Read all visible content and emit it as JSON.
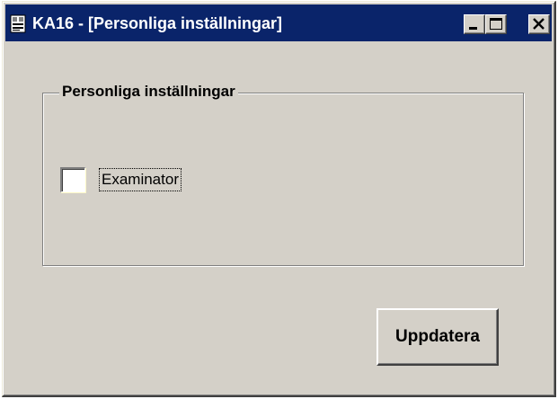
{
  "window": {
    "title": "KA16 - [Personliga inställningar]",
    "icon": "document-icon",
    "controls": {
      "minimize": "minimize-icon",
      "maximize": "maximize-icon",
      "close": "close-icon"
    }
  },
  "group": {
    "legend": "Personliga inställningar",
    "checkbox": {
      "label": "Examinator",
      "checked": false
    }
  },
  "actions": {
    "update_label": "Uppdatera"
  },
  "colors": {
    "titlebar": "#0a246a",
    "face": "#d4d0c8"
  }
}
